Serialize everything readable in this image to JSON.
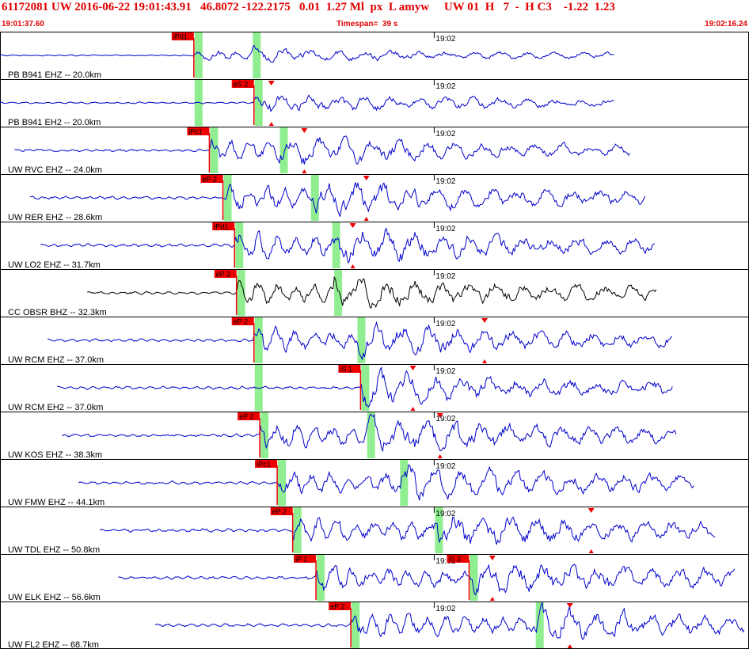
{
  "header": {
    "title": "61172081 UW 2016-06-22 19:01:43.91   46.8072 -122.2175   0.01  1.27 Ml  px  L amyw     UW 01  H   7  -  H C3    -1.22  1.23",
    "start_time": "19:01:37.60",
    "timespan": "Timespan=  39 s",
    "end_time": "19:02:16.24"
  },
  "colors": {
    "header_text": "#e00000",
    "trace": "#0000cc",
    "trace_alt": "#000000",
    "pick_flag": "#ee0000",
    "pick_window": "#90ee90",
    "amp_marker": "#ee0000"
  },
  "chart_data": {
    "type": "line",
    "title": "",
    "x_unit": "seconds since 19:01:37.60",
    "xlim": [
      0,
      38.64
    ],
    "minute_label": "19:02",
    "minute_mark": 22.4,
    "channels": [
      {
        "label": "PB B941 EHZ -- 20.0km",
        "dist": 20.0,
        "color": "blue",
        "start": 0.0,
        "end": 31.7,
        "amp": 0.11,
        "picks": [
          {
            "label": "iPd1",
            "t": 10.0,
            "line": true
          }
        ],
        "windows": [
          10.0,
          13.0
        ],
        "amp_markers": []
      },
      {
        "label": "PB B941 EH2 -- 20.0km",
        "dist": 20.0,
        "color": "blue",
        "start": 0.0,
        "end": 31.7,
        "amp": 0.16,
        "picks": [
          {
            "label": "eS 2",
            "t": 13.1,
            "line": true
          }
        ],
        "windows": [
          10.0,
          13.1
        ],
        "amp_markers": [
          14.0
        ]
      },
      {
        "label": "UW RVC EHZ -- 24.0km",
        "dist": 24.0,
        "color": "blue",
        "start": 0.75,
        "end": 32.5,
        "amp": 0.22,
        "picks": [
          {
            "label": "iPc1",
            "t": 10.8,
            "line": true
          }
        ],
        "windows": [
          10.8,
          14.4
        ],
        "amp_markers": [
          15.7
        ]
      },
      {
        "label": "UW RER EHZ -- 28.6km",
        "dist": 28.6,
        "color": "blue",
        "start": 1.55,
        "end": 33.3,
        "amp": 0.26,
        "picks": [
          {
            "label": "eP 2",
            "t": 11.5,
            "line": true
          }
        ],
        "windows": [
          11.5,
          16.0
        ],
        "amp_markers": [
          18.9
        ]
      },
      {
        "label": "UW LO2 EHZ -- 31.7km",
        "dist": 31.7,
        "color": "blue",
        "start": 2.1,
        "end": 33.8,
        "amp": 0.28,
        "picks": [
          {
            "label": "iPd1",
            "t": 12.1,
            "line": true
          }
        ],
        "windows": [
          12.1,
          17.1
        ],
        "amp_markers": [
          18.2
        ]
      },
      {
        "label": "CC OBSR BHZ -- 32.3km",
        "dist": 32.3,
        "color": "black",
        "start": 4.5,
        "end": 33.9,
        "amp": 0.24,
        "picks": [
          {
            "label": "eP 2",
            "t": 12.2,
            "line": true
          }
        ],
        "windows": [
          12.2,
          17.2
        ],
        "amp_markers": []
      },
      {
        "label": "UW RCM EHZ -- 37.0km",
        "dist": 37.0,
        "color": "blue",
        "start": 2.45,
        "end": 34.7,
        "amp": 0.25,
        "picks": [
          {
            "label": "eP 2",
            "t": 13.1,
            "line": true
          }
        ],
        "windows": [
          13.1,
          18.4
        ],
        "amp_markers": [
          25.0
        ]
      },
      {
        "label": "UW RCM EH2 -- 37.0km",
        "dist": 37.0,
        "color": "blue",
        "start": 2.95,
        "end": 34.7,
        "amp": 0.26,
        "picks": [
          {
            "label": "iS 1",
            "t": 18.6,
            "line": true
          }
        ],
        "windows": [
          13.1,
          18.6
        ],
        "amp_markers": [
          21.3
        ]
      },
      {
        "label": "UW KOS EHZ -- 38.3km",
        "dist": 38.3,
        "color": "blue",
        "start": 3.2,
        "end": 34.9,
        "amp": 0.26,
        "picks": [
          {
            "label": "eP 2",
            "t": 13.4,
            "line": true
          }
        ],
        "windows": [
          13.4,
          18.9
        ],
        "amp_markers": [
          22.7
        ]
      },
      {
        "label": "UW FMW EHZ -- 44.1km",
        "dist": 44.1,
        "color": "blue",
        "start": 4.05,
        "end": 35.8,
        "amp": 0.26,
        "picks": [
          {
            "label": "iPc1",
            "t": 14.3,
            "line": true
          }
        ],
        "windows": [
          14.3,
          20.6
        ],
        "amp_markers": []
      },
      {
        "label": "UW TDL EHZ -- 50.8km",
        "dist": 50.8,
        "color": "blue",
        "start": 5.15,
        "end": 36.9,
        "amp": 0.27,
        "picks": [
          {
            "label": "eP 2",
            "t": 15.1,
            "line": true
          }
        ],
        "windows": [
          15.1,
          22.4
        ],
        "amp_markers": [
          30.5
        ]
      },
      {
        "label": "UW ELK EHZ -- 56.6km",
        "dist": 56.6,
        "color": "blue",
        "start": 6.1,
        "end": 37.9,
        "amp": 0.27,
        "picks": [
          {
            "label": "iP 1",
            "t": 16.3,
            "line": true
          },
          {
            "label": "iS 3",
            "t": 24.2,
            "line": true
          }
        ],
        "windows": [
          16.3,
          24.2
        ],
        "amp_markers": [
          25.4
        ]
      },
      {
        "label": "UW FL2 EHZ -- 68.7km",
        "dist": 68.7,
        "color": "blue",
        "start": 8.0,
        "end": 39.8,
        "amp": 0.26,
        "picks": [
          {
            "label": "eP 2",
            "t": 18.1,
            "line": true
          }
        ],
        "windows": [
          18.1,
          27.6
        ],
        "amp_markers": [
          29.4
        ]
      }
    ]
  }
}
